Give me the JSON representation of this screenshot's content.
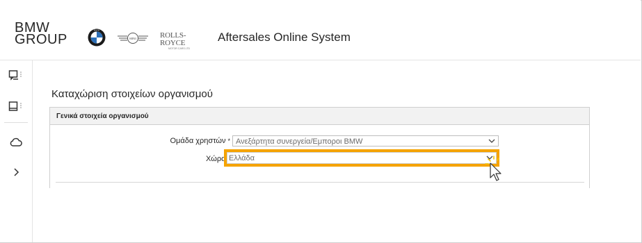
{
  "header": {
    "brand_line1": "BMW",
    "brand_line2": "GROUP",
    "rr_logo_main": "ROLLS-ROYCE",
    "rr_logo_sub": "MOTOR CARS LTD",
    "mini_logo_text": "MINI",
    "app_title": "Aftersales Online System"
  },
  "sidebar": {
    "items": [
      {
        "icon": "chat-window-icon"
      },
      {
        "icon": "document-panel-icon"
      },
      {
        "icon": "cloud-icon"
      },
      {
        "icon": "chevron-right-icon"
      }
    ]
  },
  "main": {
    "page_title": "Καταχώριση στοιχείων οργανισμού",
    "panel_title": "Γενικά στοιχεία οργανισμού",
    "fields": [
      {
        "label": "Ομάδα χρηστών",
        "required": "*",
        "value": "Ανεξάρτητα συνεργεία/Εμποροι BMW"
      },
      {
        "label": "Χώρα",
        "required": "*",
        "value": "Ελλάδα"
      }
    ]
  },
  "colors": {
    "highlight": "#f5a300",
    "bmw_blue": "#2c6fb7"
  }
}
